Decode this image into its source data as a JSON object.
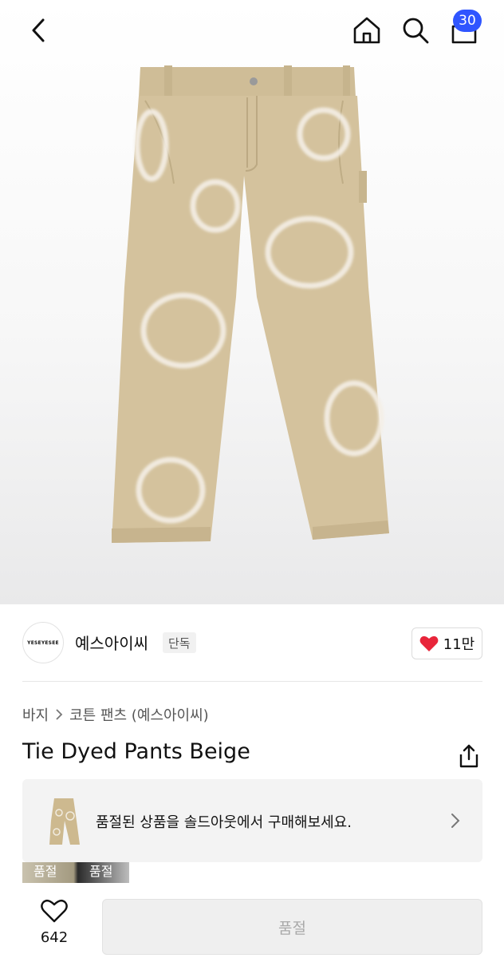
{
  "header": {
    "cart_count": "30"
  },
  "brand": {
    "logo_text": "YESEYESEE",
    "name": "예스아이씨",
    "exclusive_tag": "단독",
    "likes": "11만"
  },
  "breadcrumb": {
    "category": "바지",
    "subcategory": "코튼 팬츠 (예스아이씨)"
  },
  "product": {
    "title": "Tie Dyed Pants Beige"
  },
  "soldout_banner": {
    "text": "품절된 상품을 솔드아웃에서 구매해보세요."
  },
  "tags": [
    "품절",
    "품절"
  ],
  "footer": {
    "wish_count": "642",
    "cta_label": "품절"
  },
  "colors": {
    "badge": "#2f55ff",
    "heart": "#e8253a",
    "pants": "#d4c29d"
  },
  "icons": [
    "back-icon",
    "home-icon",
    "search-icon",
    "cart-icon",
    "heart-icon",
    "share-icon",
    "chevron-right-icon"
  ]
}
